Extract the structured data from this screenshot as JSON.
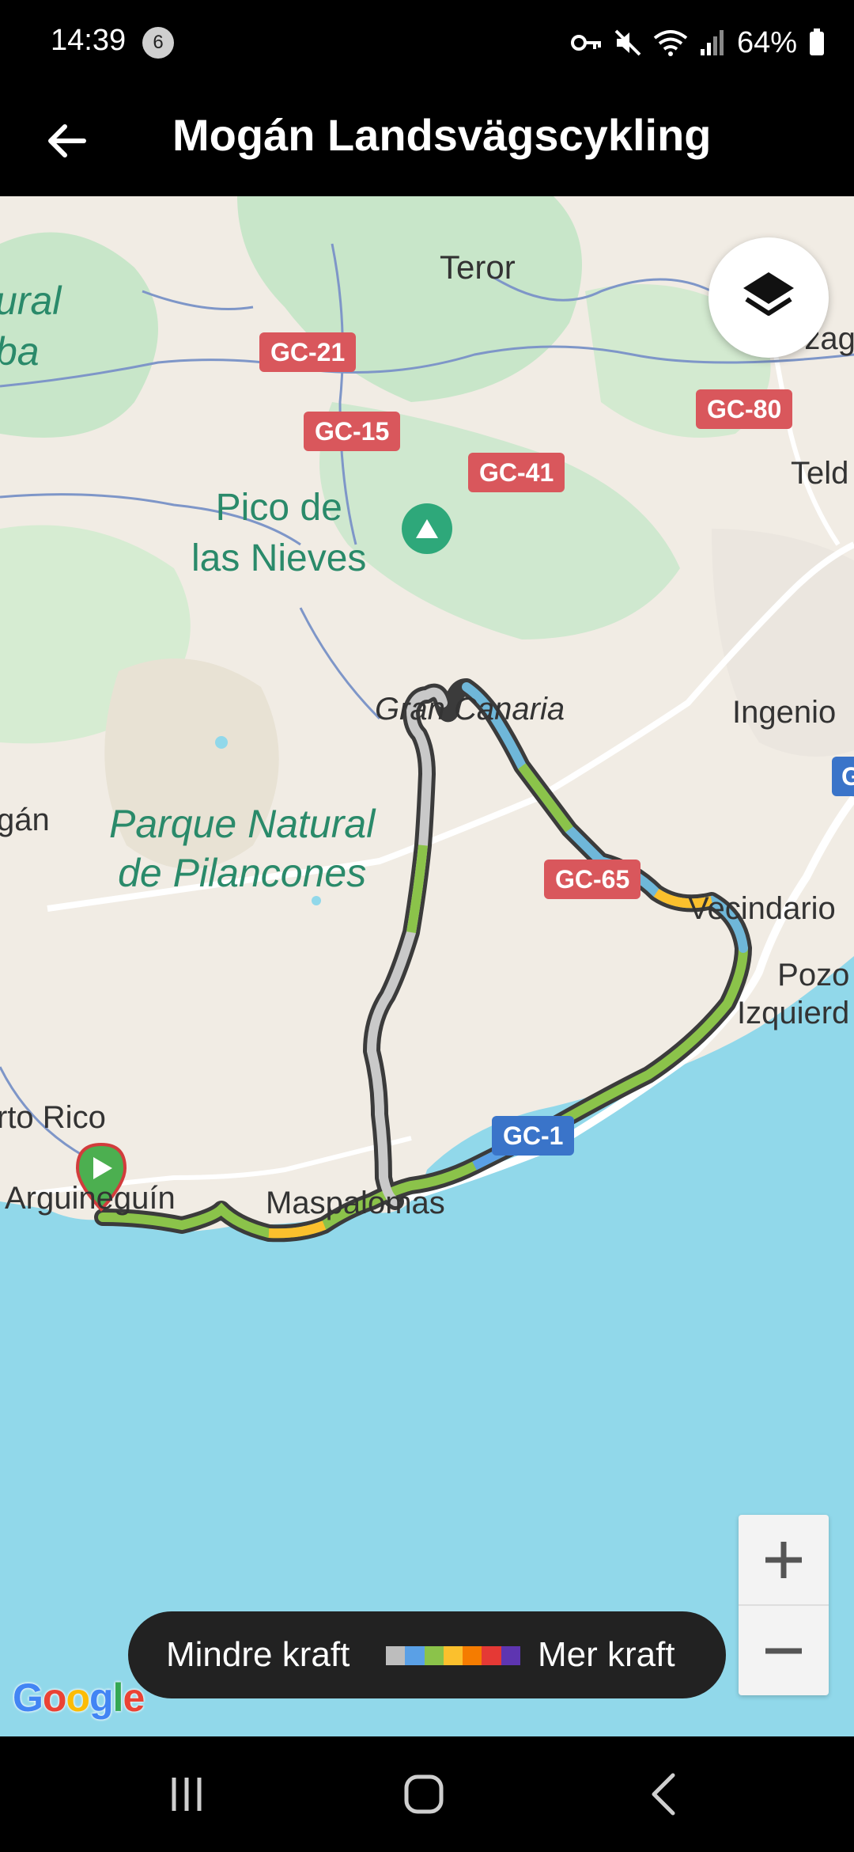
{
  "status_bar": {
    "time": "14:39",
    "notification_count": "6",
    "battery": "64%",
    "icons": [
      "key-icon",
      "mute-icon",
      "wifi-icon",
      "signal-icon",
      "battery-icon"
    ]
  },
  "app_bar": {
    "title": "Mogán Landsvägscykling",
    "back_icon": "arrow-left-icon"
  },
  "map": {
    "place_labels": {
      "teror": "Teror",
      "pico": "Pico de\nlas Nieves",
      "gran_canaria": "Gran Canaria",
      "ingenio": "Ingenio",
      "parque": "Parque Natural\nde Pilancones",
      "vecindario": "Vecindario",
      "pozo": "Pozo\nIzquierd",
      "puerto_rico": "rto Rico",
      "arguineguin": "Arguineguín",
      "maspalomas": "Maspalomas",
      "mogan": "gán",
      "left_park": "ural\nba",
      "telde": "Teld",
      "arzag": "rzag"
    },
    "road_shields": {
      "gc21": "GC-21",
      "gc15": "GC-15",
      "gc41": "GC-41",
      "gc80": "GC-80",
      "gc65": "GC-65",
      "gc1": "GC-1",
      "g": "G"
    },
    "colors": {
      "sea": "#91d8ea",
      "land": "#f1ece4",
      "forest": "#c8e6c9",
      "route_outline": "#3b3b3b",
      "start_marker": "#4caf50"
    },
    "layers_icon": "layers-icon",
    "zoom_in_icon": "plus-icon",
    "zoom_out_icon": "minus-icon",
    "attribution": "Google"
  },
  "legend": {
    "min_label": "Mindre kraft",
    "max_label": "Mer kraft",
    "gradient_colors": [
      "#bdbdbd",
      "#5aa0e6",
      "#8bc34a",
      "#fbc02d",
      "#f57c00",
      "#e53935",
      "#5e35b1"
    ]
  },
  "nav_bar": {
    "icons": [
      "recents-icon",
      "home-icon",
      "back-icon"
    ]
  }
}
